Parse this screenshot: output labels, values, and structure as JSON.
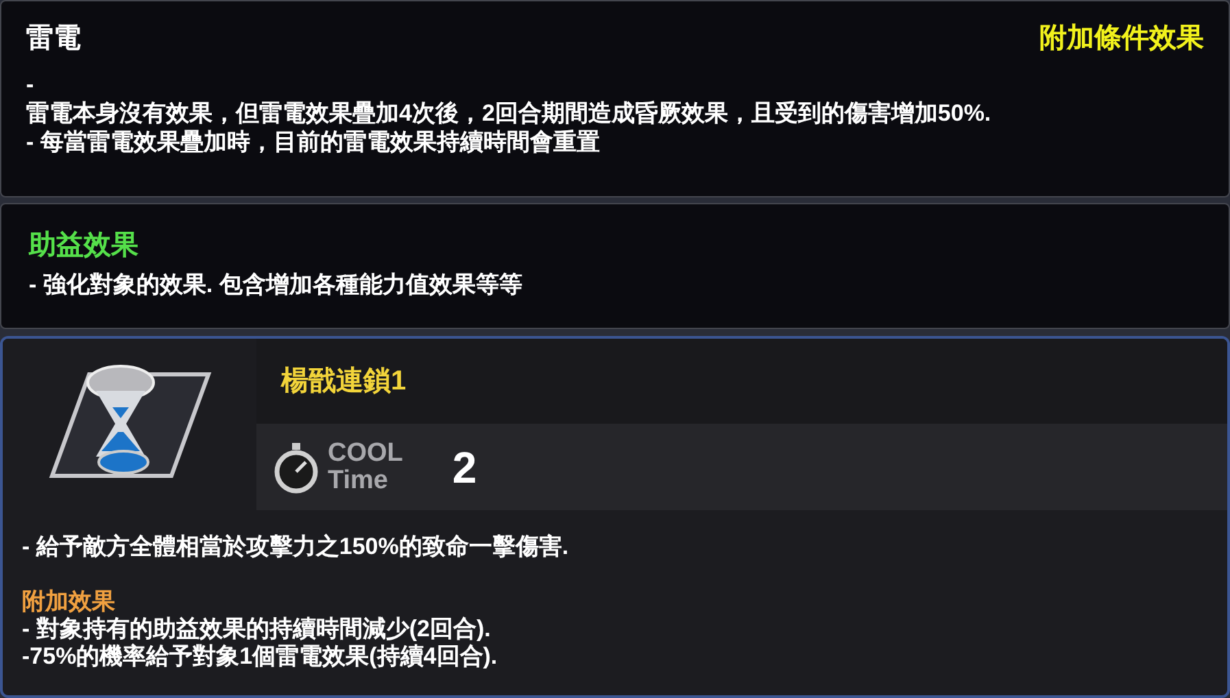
{
  "condition_panel": {
    "title": "雷電",
    "tag": "附加條件效果",
    "lines": [
      "-",
      "雷電本身沒有效果，但雷電效果疊加4次後，2回合期間造成昏厥效果，且受到的傷害增加50%.",
      "- 每當雷電效果疊加時，目前的雷電效果持續時間會重置"
    ]
  },
  "buff_panel": {
    "title": "助益效果",
    "description": "- 強化對象的效果. 包含增加各種能力值效果等等"
  },
  "skill_card": {
    "name": "楊戩連鎖1",
    "cooldown_label": [
      "COOL",
      "Time"
    ],
    "cooldown_value": "2",
    "description": "- 給予敵方全體相當於攻擊力之150%的致命一擊傷害.",
    "extra_title": "附加效果",
    "extra_lines": [
      "- 對象持有的助益效果的持續時間減少(2回合).",
      "-75%的機率給予對象1個雷電效果(持續4回合)."
    ]
  }
}
